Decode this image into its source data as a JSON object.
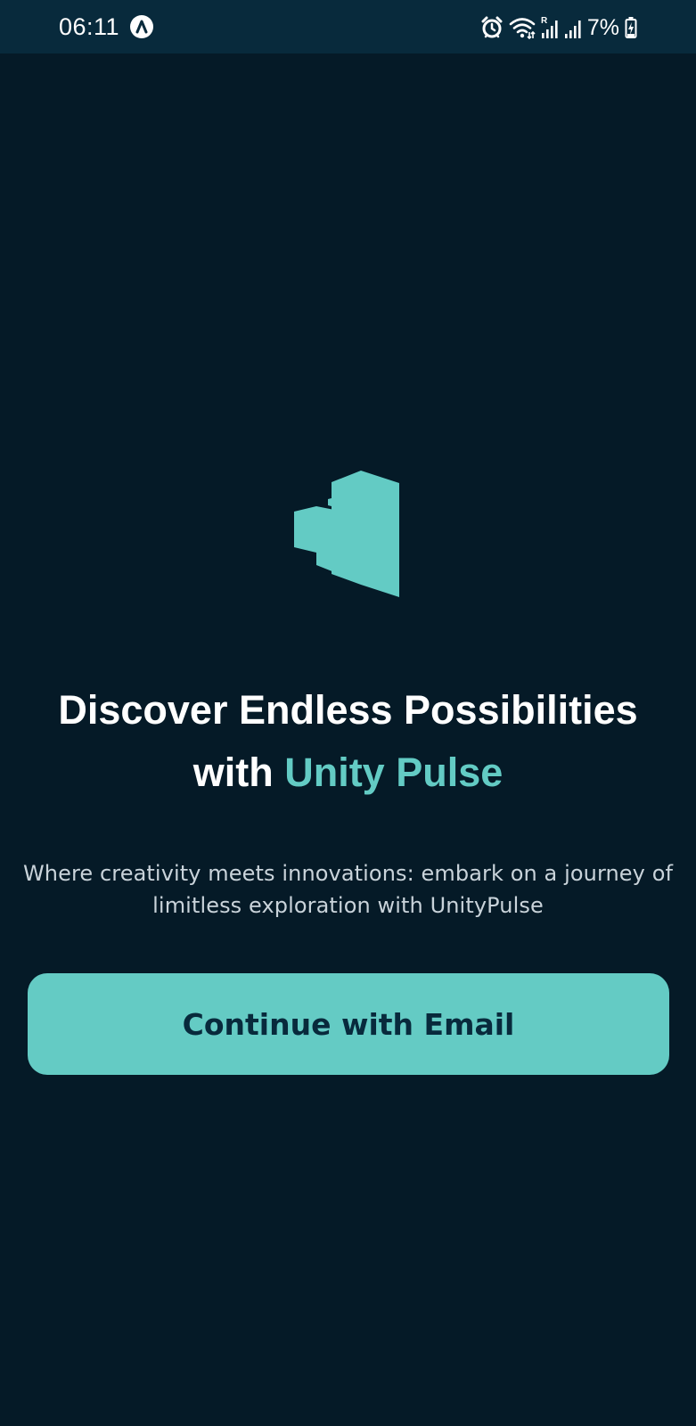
{
  "status_bar": {
    "time": "06:11",
    "battery": "7%",
    "icons": [
      "navigation-icon",
      "alarm-icon",
      "wifi-icon",
      "signal-roaming-icon",
      "signal-icon",
      "battery-charging-icon"
    ]
  },
  "logo": {
    "icon": "unity-pulse-logo",
    "color": "#63cbc4"
  },
  "headline": {
    "line1": "Discover Endless Possibilities",
    "prefix": "with ",
    "brand": "Unity Pulse"
  },
  "subtitle": "Where creativity meets innovations: embark on a journey of limitless exploration with UnityPulse",
  "cta": {
    "label": "Continue with Email"
  },
  "colors": {
    "background": "#051a27",
    "status_bar": "#082a3c",
    "accent": "#63cbc4",
    "button_text": "#082a3c"
  }
}
